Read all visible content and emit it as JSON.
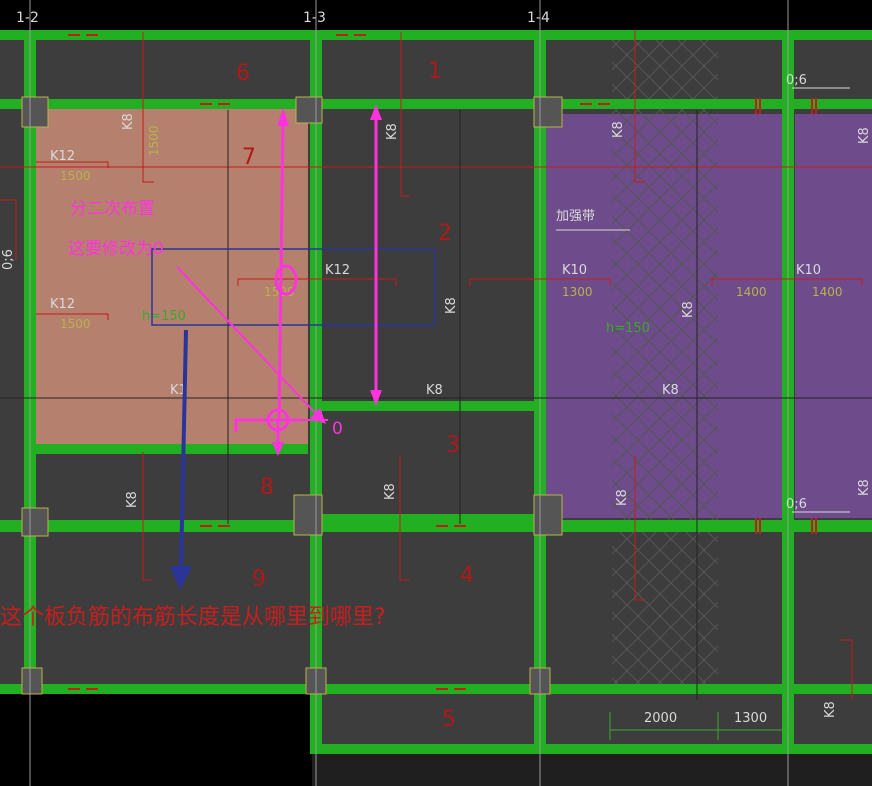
{
  "axes": [
    "1-2",
    "1-3",
    "1-4"
  ],
  "panels": [
    "6",
    "1",
    "7",
    "2",
    "3",
    "8",
    "9",
    "4",
    "5"
  ],
  "rebar_labels": {
    "k8": "K8",
    "k12": "K12",
    "k10": "K10",
    "k1": "K1",
    "v1500": "1500",
    "v1300": "1300",
    "v1400": "1400",
    "v2000": "2000",
    "h150": "h=150",
    "d06": "0;6",
    "jiaqiangdai": "加强带"
  },
  "annotations": {
    "note1": "分二次布置",
    "note2": "这要修改为0",
    "zero": "0",
    "question": "这个板负筋的布筋长度是从哪里到哪里?"
  },
  "colors": {
    "background": "#3d3d3d",
    "beam": "#22b022",
    "slab_highlight": "#b5816e",
    "slab_purple": "#6e4c8c",
    "annotation_magenta": "#ff33dd",
    "arrow_blue": "#2a3499",
    "rebar_red": "#c41b1b"
  }
}
